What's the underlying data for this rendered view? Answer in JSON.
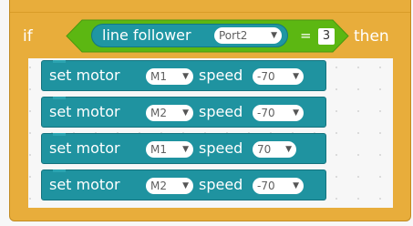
{
  "if_block": {
    "if_label": "if",
    "then_label": "then",
    "condition": {
      "sensor_label": "line follower",
      "port_value": "Port2",
      "operator": "=",
      "compare_value": "3"
    }
  },
  "motor_blocks": [
    {
      "prefix": "set motor",
      "motor": "M1",
      "speed_label": "speed",
      "speed": "-70"
    },
    {
      "prefix": "set motor",
      "motor": "M2",
      "speed_label": "speed",
      "speed": "-70"
    },
    {
      "prefix": "set motor",
      "motor": "M1",
      "speed_label": "speed",
      "speed": "70"
    },
    {
      "prefix": "set motor",
      "motor": "M2",
      "speed_label": "speed",
      "speed": "-70"
    }
  ],
  "colors": {
    "control": "#e8ad3b",
    "operator": "#5cb712",
    "sensor": "#1f96a3",
    "motor": "#1f93a0"
  }
}
